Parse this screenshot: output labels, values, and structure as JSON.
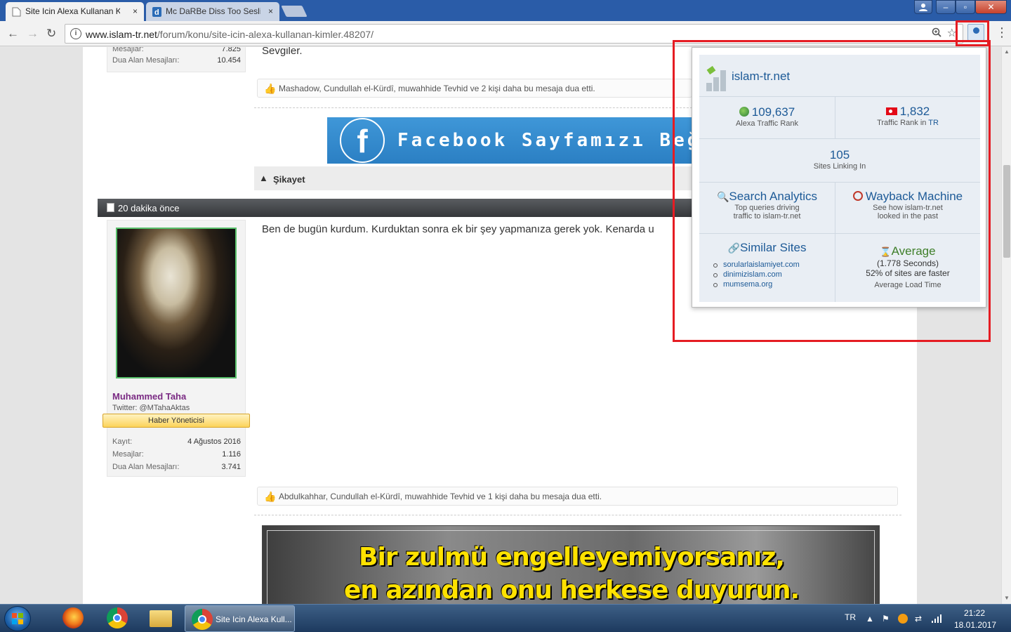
{
  "browser": {
    "tabs": [
      {
        "title": "Site Icin Alexa Kullanan K",
        "close": "×"
      },
      {
        "title": "Mc DaRBe Diss Too Sesli",
        "close": "×"
      }
    ],
    "window_controls": {
      "min": "–",
      "max": "▫",
      "close": "✕"
    },
    "nav": {
      "back": "←",
      "forward": "→",
      "reload": "↻"
    },
    "url_host": "www.islam-tr.net",
    "url_path": "/forum/konu/site-icin-alexa-kullanan-kimler.48207/",
    "icons": [
      "info-icon",
      "zoom-icon",
      "star-icon",
      "alexa-extension-icon",
      "menu-icon"
    ]
  },
  "post1": {
    "stats": [
      {
        "label": "Mesajlar:",
        "value": "7.825"
      },
      {
        "label": "Dua Alan Mesajları:",
        "value": "10.454"
      }
    ],
    "text": "Sevgiler.",
    "likes": "Mashadow, Cundullah el-Kürdî, muwahhide Tevhid ve 2 kişi daha bu mesaja dua etti.",
    "facebook_banner": "Facebook Sayfamızı Beğendi",
    "report_label": "Şikayet"
  },
  "post2": {
    "header_time": "20 dakika önce",
    "user": {
      "name": "Muhammed Taha",
      "twitter": "Twitter: @MTahaAktas",
      "rank": "Haber Yöneticisi",
      "stats": [
        {
          "label": "Kayıt:",
          "value": "4 Ağustos 2016"
        },
        {
          "label": "Mesajlar:",
          "value": "1.116"
        },
        {
          "label": "Dua Alan Mesajları:",
          "value": "3.741"
        }
      ]
    },
    "text": "Ben de bugün kurdum. Kurduktan sonra ek bir şey yapmanıza gerek yok. Kenarda u",
    "likes": "Abdulkahhar, Cundullah el-Kürdî, muwahhide Tevhid ve 1 kişi daha bu mesaja dua etti.",
    "banner_line1": "Bir zulmü engelleyemiyorsanız,",
    "banner_line2": "en azından onu herkese duyurun."
  },
  "alexa": {
    "site": "islam-tr.net",
    "global_rank": "109,637",
    "global_rank_label": "Alexa Traffic Rank",
    "country_rank": "1,832",
    "country_rank_label": "Traffic Rank in",
    "country_code": "TR",
    "sites_linking": "105",
    "sites_linking_label": "Sites Linking In",
    "search_analytics_title": "Search Analytics",
    "search_analytics_line1": "Top queries driving",
    "search_analytics_line2": "traffic to islam-tr.net",
    "wayback_title": "Wayback Machine",
    "wayback_line1": "See how islam-tr.net",
    "wayback_line2": "looked in the past",
    "similar_title": "Similar Sites",
    "similar_sites": [
      "sorularlaislamiyet.com",
      "dinimizislam.com",
      "mumsema.org"
    ],
    "load_title": "Average",
    "load_seconds": "(1.778 Seconds)",
    "load_faster": "52% of sites are faster",
    "load_label": "Average Load Time"
  },
  "taskbar": {
    "window_label": "Site Icin Alexa Kull...",
    "lang": "TR",
    "time": "21:22",
    "date": "18.01.2017"
  },
  "colors": {
    "titlebar": "#2a5ca8",
    "highlight": "#e51c23",
    "alexa_blue": "#1d5a97",
    "username": "#7a2a83"
  }
}
